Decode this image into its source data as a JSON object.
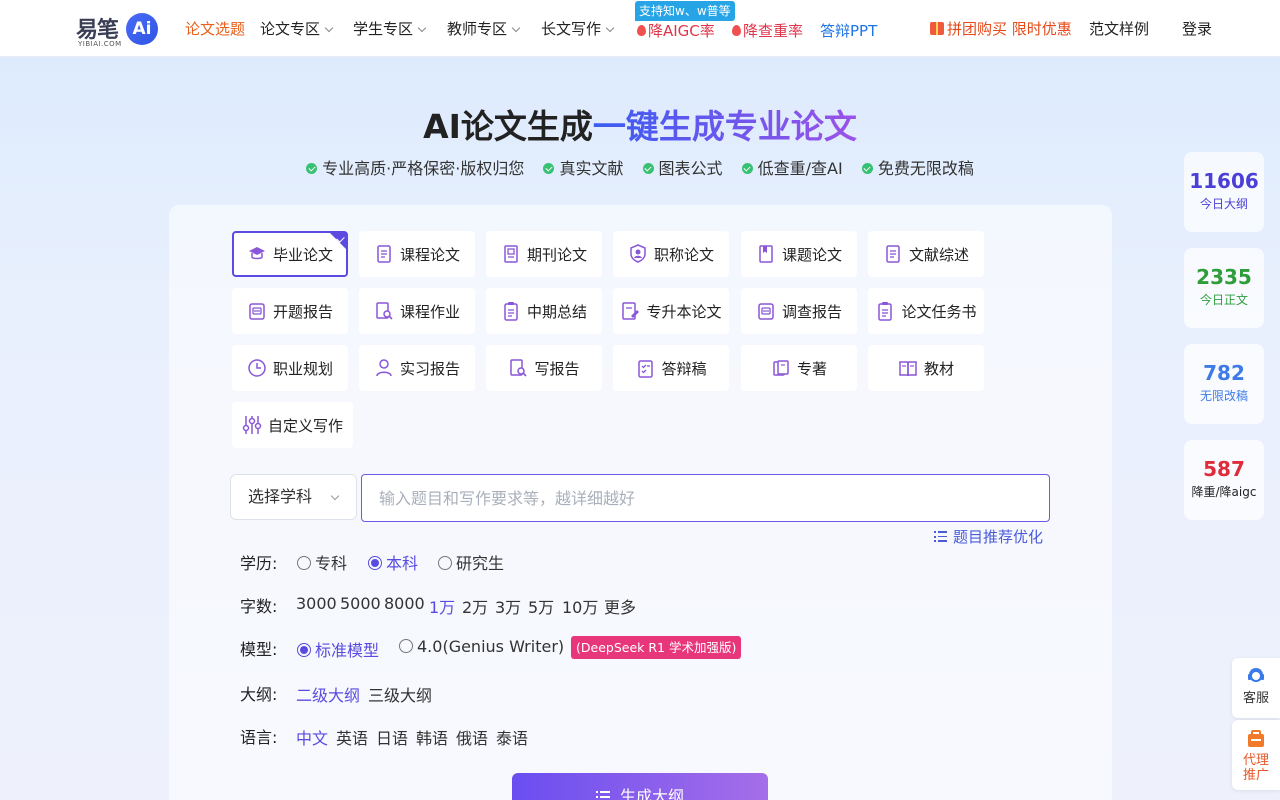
{
  "logo": {
    "cn": "易笔",
    "ai": "Ai",
    "sub": "YIBIAI.COM"
  },
  "nav": {
    "topic": "论文选题",
    "paper_zone": "论文专区",
    "student_zone": "学生专区",
    "teacher_zone": "教师专区",
    "long_writing": "长文写作",
    "badge": "支持知w、w普等",
    "reduce_aigc": "降AIGC率",
    "reduce_dup": "降查重率",
    "defense_ppt": "答辩PPT",
    "group_buy": "拼团购买 限时优惠",
    "samples": "范文样例",
    "login": "登录"
  },
  "hero": {
    "title_a": "AI论文生成",
    "title_b": "一键生成专业论文",
    "features": [
      "专业高质·严格保密·版权归您",
      "真实文献",
      "图表公式",
      "低查重/查AI",
      "免费无限改稿"
    ]
  },
  "types": [
    {
      "label": "毕业论文",
      "icon": "graduation-cap-icon"
    },
    {
      "label": "课程论文",
      "icon": "document-icon"
    },
    {
      "label": "期刊论文",
      "icon": "journal-icon"
    },
    {
      "label": "职称论文",
      "icon": "shield-icon"
    },
    {
      "label": "课题论文",
      "icon": "book-icon"
    },
    {
      "label": "文献综述",
      "icon": "document-icon"
    },
    {
      "label": "开题报告",
      "icon": "report-icon"
    },
    {
      "label": "课程作业",
      "icon": "search-doc-icon"
    },
    {
      "label": "中期总结",
      "icon": "clipboard-icon"
    },
    {
      "label": "专升本论文",
      "icon": "doc-edit-icon"
    },
    {
      "label": "调查报告",
      "icon": "report-icon"
    },
    {
      "label": "论文任务书",
      "icon": "clipboard-icon"
    },
    {
      "label": "职业规划",
      "icon": "clock-icon"
    },
    {
      "label": "实习报告",
      "icon": "user-icon"
    },
    {
      "label": "写报告",
      "icon": "search-doc-icon"
    },
    {
      "label": "答辩稿",
      "icon": "checklist-icon"
    },
    {
      "label": "专著",
      "icon": "books-icon"
    },
    {
      "label": "教材",
      "icon": "open-book-icon"
    },
    {
      "label": "自定义写作",
      "icon": "sliders-icon"
    }
  ],
  "form": {
    "subject": "选择学科",
    "topic_placeholder": "输入题目和写作要求等，越详细越好",
    "recommend": "题目推荐优化",
    "education_label": "学历:",
    "education": [
      "专科",
      "本科",
      "研究生"
    ],
    "education_selected": "本科",
    "words_label": "字数:",
    "words": [
      "3000",
      "5000",
      "8000",
      "1万",
      "2万",
      "3万",
      "5万",
      "10万",
      "更多"
    ],
    "words_selected": "1万",
    "model_label": "模型:",
    "model_standard": "标准模型",
    "model_genius": "4.0(Genius Writer)",
    "model_badge": "(DeepSeek R1 学术加强版)",
    "outline_label": "大纲:",
    "outline": [
      "二级大纲",
      "三级大纲"
    ],
    "outline_selected": "二级大纲",
    "lang_label": "语言:",
    "languages": [
      "中文",
      "英语",
      "日语",
      "韩语",
      "俄语",
      "泰语"
    ],
    "lang_selected": "中文",
    "generate": "生成大纲"
  },
  "stats": [
    {
      "num": "11606",
      "label": "今日大纲",
      "color": "#4b3fd6"
    },
    {
      "num": "2335",
      "label": "今日正文",
      "color": "#2e9d3a"
    },
    {
      "num": "782",
      "label": "无限改稿",
      "color": "#3f7be6"
    },
    {
      "num": "587",
      "label": "降重/降aigc",
      "color": "#e02b3a"
    }
  ],
  "float": {
    "service": "客服",
    "agent_a": "代理",
    "agent_b": "推广"
  },
  "colors": {
    "accent": "#5b4be0",
    "nav_active": "#e8601c",
    "hot": "#e0344a",
    "link": "#1f74e6"
  }
}
